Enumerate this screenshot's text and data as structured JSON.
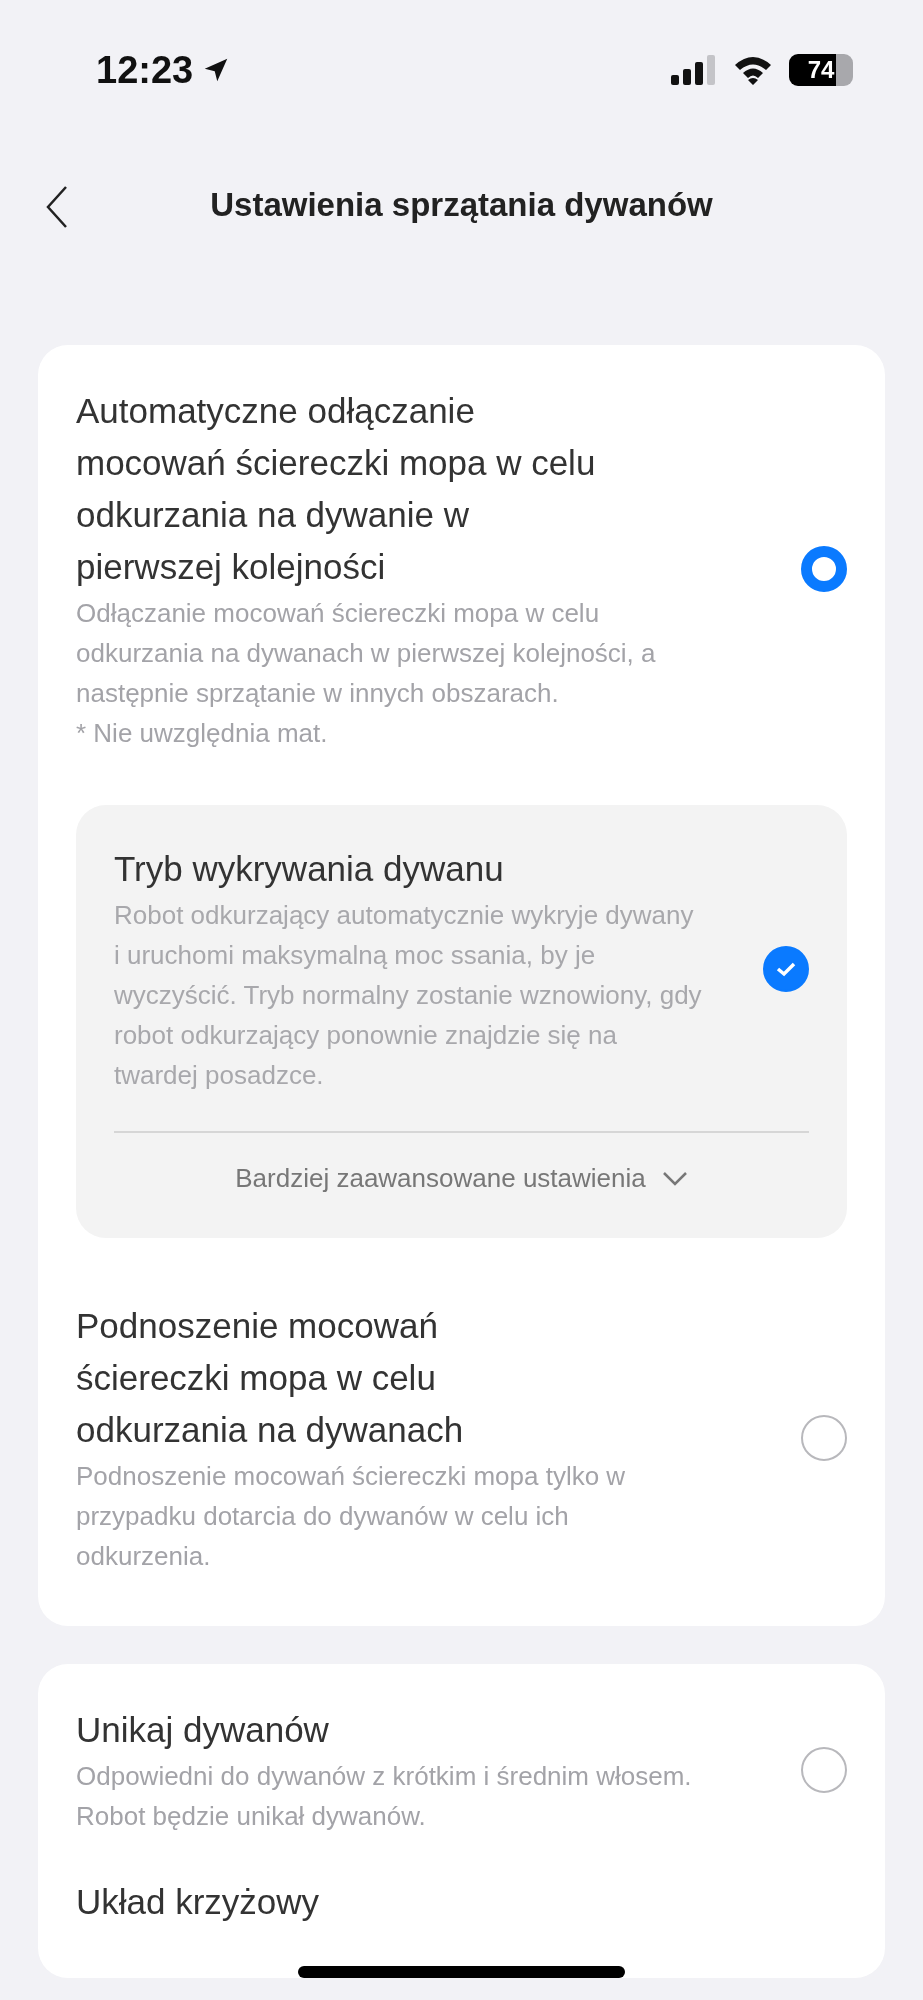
{
  "status_bar": {
    "time": "12:23",
    "battery": "74"
  },
  "header": {
    "title": "Ustawienia sprzątania dywanów"
  },
  "groups": [
    {
      "options": [
        {
          "kind": "radio",
          "title": "Automatyczne odłączanie mocowań ściereczki mopa w celu odkurzania na dywanie w pierwszej kolejności",
          "description": "Odłączanie mocowań ściereczki mopa w celu odkurzania na dywanach w pierwszej kolejności, a następnie sprzątanie w innych obszarach.\n* Nie uwzględnia mat.",
          "selected": true,
          "sub_panel": {
            "title": "Tryb wykrywania dywanu",
            "description": "Robot odkurzający automatycznie wykryje dywany i uruchomi maksymalną moc ssania, by je wyczyścić. Tryb normalny zostanie wznowiony, gdy robot odkurzający ponownie znajdzie się na twardej posadzce.",
            "checked": true,
            "more_label": "Bardziej zaawansowane ustawienia"
          }
        },
        {
          "kind": "radio",
          "title": "Podnoszenie mocowań ściereczki mopa w celu odkurzania na dywanach",
          "description": "Podnoszenie mocowań ściereczki mopa tylko w przypadku dotarcia do dywanów w celu ich odkurzenia.",
          "selected": false
        }
      ]
    },
    {
      "options": [
        {
          "kind": "radio",
          "title": "Unikaj dywanów",
          "description": "Odpowiedni do dywanów z krótkim i średnim włosem. Robot będzie unikał dywanów.",
          "selected": false
        },
        {
          "kind": "heading",
          "title": "Układ krzyżowy"
        }
      ]
    }
  ]
}
